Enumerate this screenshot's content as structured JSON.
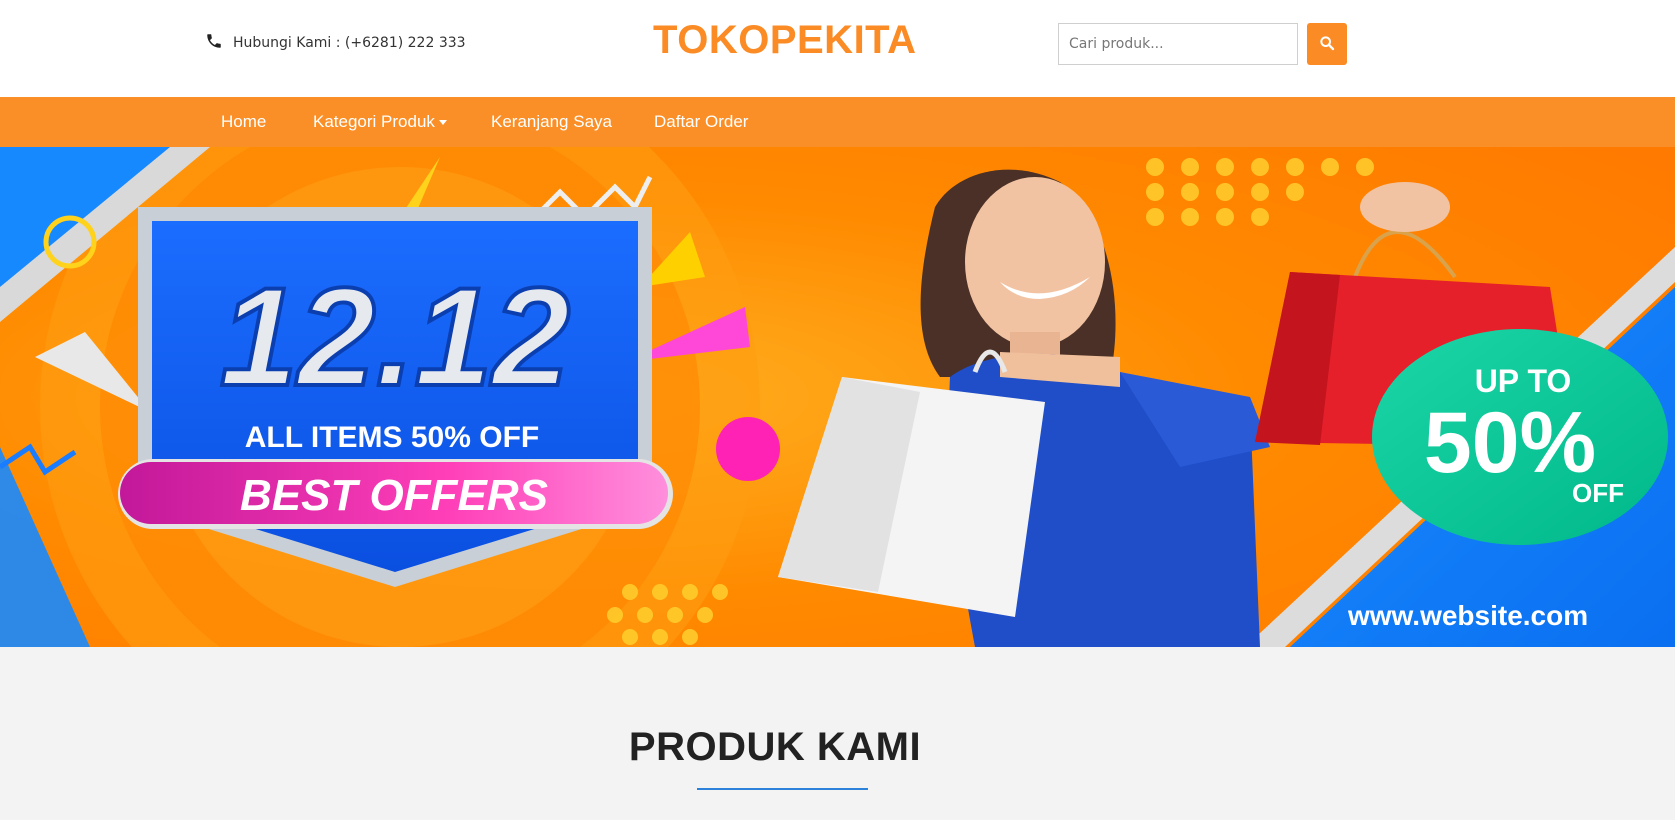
{
  "header": {
    "contact_label": "Hubungi Kami : (+6281) 222 333",
    "brand": "TOKOPEKITA",
    "search_placeholder": "Cari produk..."
  },
  "nav": {
    "items": [
      {
        "label": "Home"
      },
      {
        "label": "Kategori Produk",
        "has_dropdown": true
      },
      {
        "label": "Keranjang Saya"
      },
      {
        "label": "Daftar Order"
      }
    ]
  },
  "banner": {
    "big_text": "12.12",
    "sub_text": "ALL ITEMS 50% OFF",
    "ribbon_text": "BEST OFFERS",
    "badge_top": "UP TO",
    "badge_main": "50%",
    "badge_bottom": "OFF",
    "url": "www.website.com"
  },
  "section": {
    "title": "PRODUK KAMI"
  },
  "colors": {
    "accent": "#fb8b24",
    "nav_bg": "#fb8f27",
    "underline": "#2b82d8",
    "page_bg": "#f3f3f3"
  },
  "icons": {
    "contact": "phone-icon",
    "search": "search-icon"
  }
}
